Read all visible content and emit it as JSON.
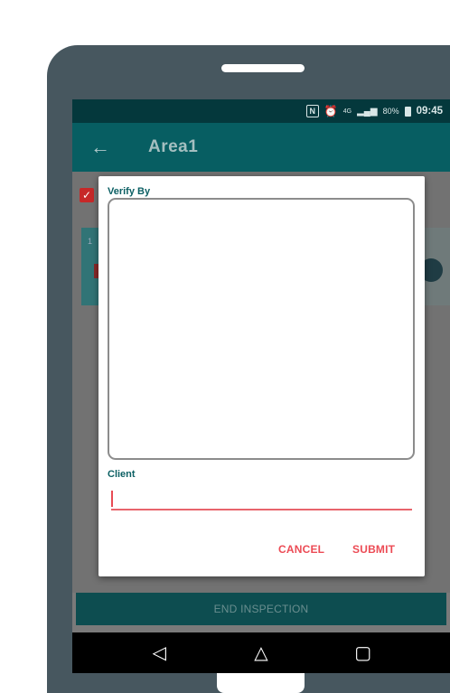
{
  "status_bar": {
    "nfc_icon": "N",
    "network": "4G",
    "battery": "80%",
    "time": "09:45"
  },
  "app_bar": {
    "back_icon": "←",
    "title": "Area1"
  },
  "card": {
    "number": "1"
  },
  "dialog": {
    "verify_label": "Verify By",
    "client_label": "Client",
    "client_value": "",
    "cancel_label": "CANCEL",
    "submit_label": "SUBMIT"
  },
  "footer": {
    "end_label": "END INSPECTION"
  },
  "nav": {
    "back_icon": "◁",
    "home_icon": "△",
    "recents_icon": "▢"
  },
  "colors": {
    "accent": "#ec4b55",
    "primary": "#075e62",
    "status_bar": "#04383c"
  }
}
